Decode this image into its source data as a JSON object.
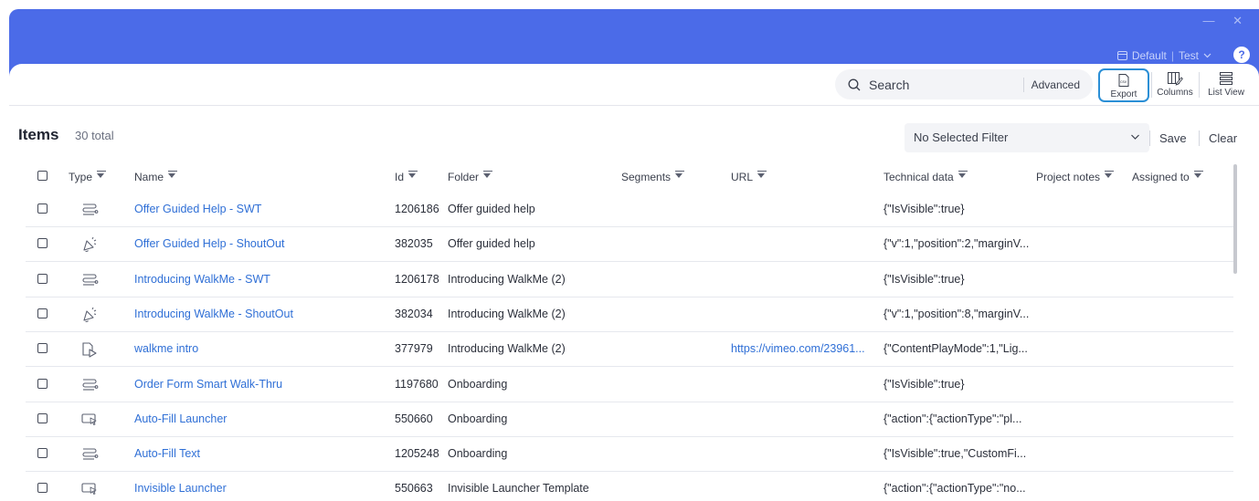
{
  "window": {
    "controls": "— ✕"
  },
  "env": {
    "default_label": "Default",
    "env_label": "Test",
    "help": "?"
  },
  "toolbar": {
    "search_placeholder": "Search",
    "advanced_label": "Advanced",
    "export_label": "Export",
    "export_badge": "csv",
    "columns_label": "Columns",
    "listview_label": "List View"
  },
  "items": {
    "title": "Items",
    "count": "30 total"
  },
  "filter": {
    "selected": "No Selected Filter",
    "save": "Save",
    "clear": "Clear"
  },
  "columns": [
    "Type",
    "Name",
    "Id",
    "Folder",
    "Segments",
    "URL",
    "Technical data",
    "Project notes",
    "Assigned to"
  ],
  "rows": [
    {
      "type": "smart-walkthru-icon",
      "name": "Offer Guided Help - SWT",
      "id": "1206186",
      "folder": "Offer guided help",
      "segments": "",
      "url": "",
      "technical": "{\"IsVisible\":true}",
      "notes": "",
      "assigned": ""
    },
    {
      "type": "shoutout-icon",
      "name": "Offer Guided Help - ShoutOut",
      "id": "382035",
      "folder": "Offer guided help",
      "segments": "",
      "url": "",
      "technical": "{\"v\":1,\"position\":2,\"marginV...",
      "notes": "",
      "assigned": ""
    },
    {
      "type": "smart-walkthru-icon",
      "name": "Introducing WalkMe - SWT",
      "id": "1206178",
      "folder": "Introducing WalkMe (2)",
      "segments": "",
      "url": "",
      "technical": "{\"IsVisible\":true}",
      "notes": "",
      "assigned": ""
    },
    {
      "type": "shoutout-icon",
      "name": "Introducing WalkMe - ShoutOut",
      "id": "382034",
      "folder": "Introducing WalkMe (2)",
      "segments": "",
      "url": "",
      "technical": "{\"v\":1,\"position\":8,\"marginV...",
      "notes": "",
      "assigned": ""
    },
    {
      "type": "video-content-icon",
      "name": "walkme intro",
      "id": "377979",
      "folder": "Introducing WalkMe (2)",
      "segments": "",
      "url": "https://vimeo.com/23961...",
      "technical": "{\"ContentPlayMode\":1,\"Lig...",
      "notes": "",
      "assigned": ""
    },
    {
      "type": "smart-walkthru-icon",
      "name": "Order Form Smart Walk-Thru",
      "id": "1197680",
      "folder": "Onboarding",
      "segments": "",
      "url": "",
      "technical": "{\"IsVisible\":true}",
      "notes": "",
      "assigned": ""
    },
    {
      "type": "launcher-icon",
      "name": "Auto-Fill Launcher",
      "id": "550660",
      "folder": "Onboarding",
      "segments": "",
      "url": "",
      "technical": "{\"action\":{\"actionType\":\"pl...",
      "notes": "",
      "assigned": ""
    },
    {
      "type": "smart-walkthru-icon",
      "name": "Auto-Fill Text",
      "id": "1205248",
      "folder": "Onboarding",
      "segments": "",
      "url": "",
      "technical": "{\"IsVisible\":true,\"CustomFi...",
      "notes": "",
      "assigned": ""
    },
    {
      "type": "launcher-icon",
      "name": "Invisible Launcher",
      "id": "550663",
      "folder": "Invisible Launcher Template",
      "segments": "",
      "url": "",
      "technical": "{\"action\":{\"actionType\":\"no...",
      "notes": "",
      "assigned": ""
    }
  ],
  "colors": {
    "header": "#4b6be8",
    "link": "#2f6fd6",
    "focus": "#2b8fd6"
  }
}
